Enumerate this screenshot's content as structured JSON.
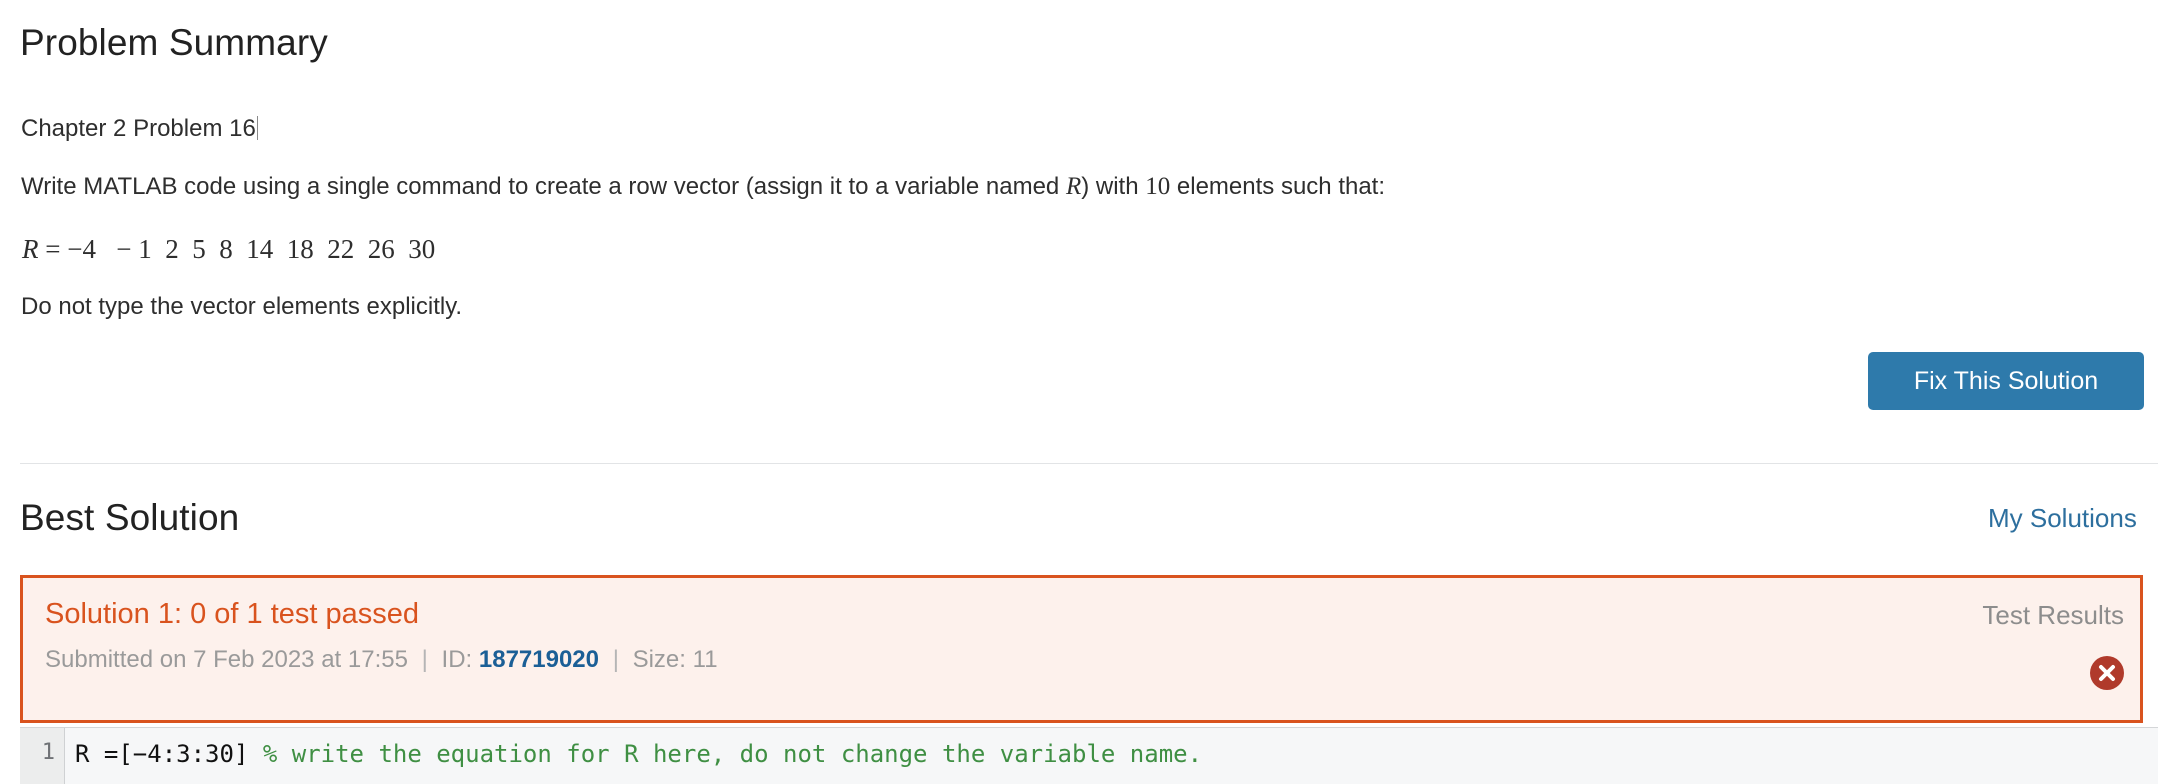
{
  "problem": {
    "section_title": "Problem Summary",
    "chapter_line": "Chapter 2 Problem 16",
    "prompt": {
      "part1": "Write MATLAB code using a single command to create a row vector (assign it to a variable named ",
      "var": "R",
      "part2": ") with ",
      "count": "10",
      "part3": " elements such that:"
    },
    "equation": {
      "lhs": "R",
      "eq": " = ",
      "values": "−4   − 1  2  5  8  14  18  22  26  30"
    },
    "note": "Do not type the vector elements explicitly.",
    "fix_button_label": "Fix This Solution"
  },
  "best_solution": {
    "section_title": "Best Solution",
    "my_solutions_label": "My Solutions",
    "panel": {
      "status_title": "Solution 1: 0 of 1 test passed",
      "submitted_prefix": "Submitted on",
      "submitted_date": "7 Feb 2023",
      "submitted_at_word": "at",
      "submitted_time": "17:55",
      "separator": "|",
      "id_label": "ID:",
      "id_value": "187719020",
      "size_label": "Size:",
      "size_value": "11",
      "test_results_label": "Test Results",
      "fail_icon": "circle-x-icon"
    },
    "code": {
      "line_number": "1",
      "code_text": "R =[−4:3:30] ",
      "comment_text": "% write the equation for R here, do not change the variable name."
    }
  },
  "colors": {
    "accent_button": "#2e7aab",
    "link": "#2d6f9e",
    "panel_border": "#d9531e",
    "panel_background": "#fdf1ec",
    "status_text": "#d9531e",
    "fail_icon": "#b03a2b",
    "comment_green": "#3f8f43",
    "divider": "#e2e4e6"
  }
}
